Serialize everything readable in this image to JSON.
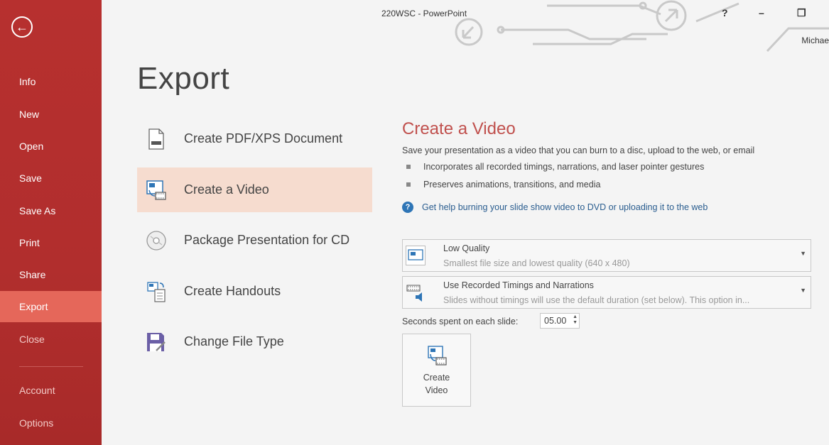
{
  "window": {
    "title": "220WSC - PowerPoint",
    "help_label": "?",
    "minimize_label": "–",
    "maximize_label": "❐",
    "user_name": "Michae"
  },
  "nav": {
    "items": [
      {
        "label": "Info"
      },
      {
        "label": "New"
      },
      {
        "label": "Open"
      },
      {
        "label": "Save"
      },
      {
        "label": "Save As"
      },
      {
        "label": "Print"
      },
      {
        "label": "Share"
      },
      {
        "label": "Export",
        "active": true
      },
      {
        "label": "Close"
      },
      {
        "label": "Account"
      },
      {
        "label": "Options"
      }
    ]
  },
  "main": {
    "title": "Export",
    "options": [
      {
        "label": "Create PDF/XPS Document",
        "icon": "pdf-document-icon"
      },
      {
        "label": "Create a Video",
        "icon": "video-icon",
        "selected": true
      },
      {
        "label": "Package Presentation for CD",
        "icon": "cd-icon"
      },
      {
        "label": "Create Handouts",
        "icon": "handouts-icon"
      },
      {
        "label": "Change File Type",
        "icon": "change-file-type-icon"
      }
    ]
  },
  "panel": {
    "title": "Create a Video",
    "description": "Save your presentation as a video that you can burn to a disc, upload to the web, or email",
    "bullets": [
      "Incorporates all recorded timings, narrations, and laser pointer gestures",
      "Preserves animations, transitions, and media"
    ],
    "help_link": "Get help burning your slide show video to DVD or uploading it to the web",
    "quality": {
      "main": "Low Quality",
      "sub": "Smallest file size and lowest quality (640 x 480)"
    },
    "timings": {
      "main": "Use Recorded Timings and Narrations",
      "sub": "Slides without timings will use the default duration (set below). This option in..."
    },
    "seconds_label": "Seconds spent on each slide:",
    "seconds_value": "05.00",
    "create_video_label": "Create\nVideo"
  },
  "colors": {
    "nav_background": "#b12e2d",
    "nav_active": "#e5675a",
    "accent_title": "#c0504d",
    "link": "#2a5d8f"
  }
}
